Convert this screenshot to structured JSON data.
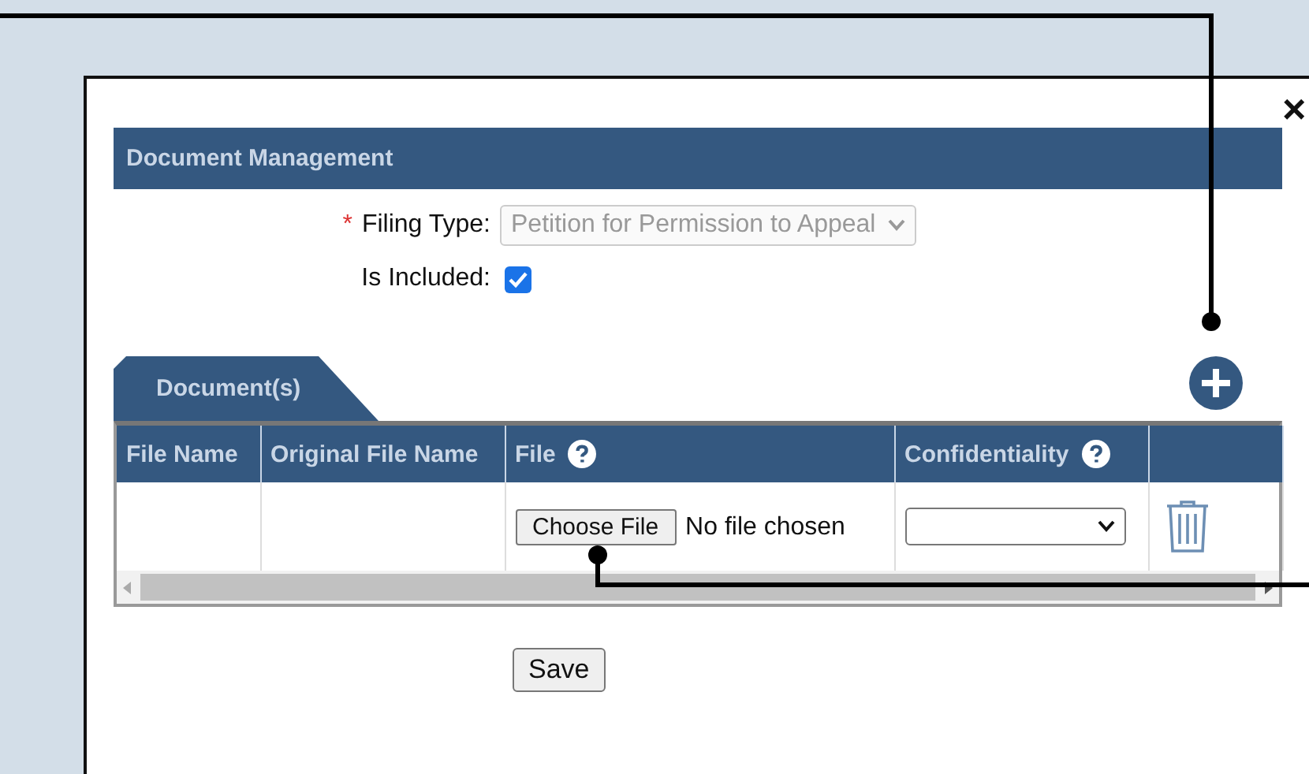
{
  "dialog": {
    "close": "×",
    "title": "Document Management",
    "filing_type": {
      "required_mark": "*",
      "label": "Filing Type:",
      "value": "Petition for Permission to Appeal",
      "disabled": true
    },
    "is_included": {
      "label": "Is Included:",
      "checked": true
    },
    "tabs": [
      {
        "label": "Document(s)",
        "selected": true
      }
    ],
    "table": {
      "columns": [
        {
          "label": "File Name",
          "help": false
        },
        {
          "label": "Original File Name",
          "help": false
        },
        {
          "label": "File",
          "help": true
        },
        {
          "label": "Confidentiality",
          "help": true
        },
        {
          "help": false
        }
      ],
      "rows": [
        {
          "file_button": "Choose File",
          "file_status": "No file chosen"
        }
      ]
    },
    "save": "Save"
  }
}
